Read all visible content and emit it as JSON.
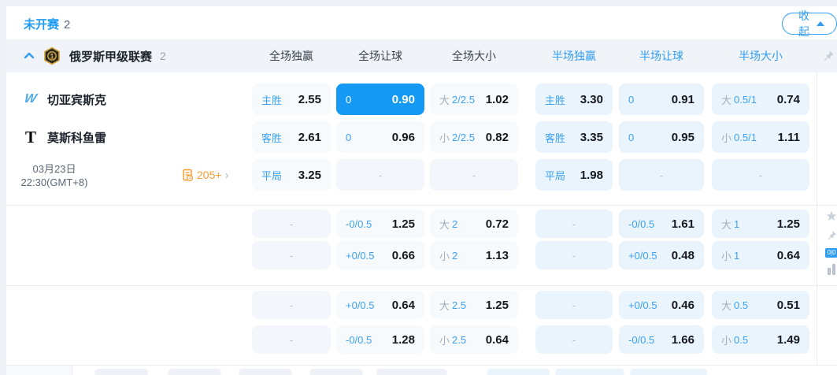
{
  "header": {
    "status_label": "未开赛",
    "status_count": "2",
    "collapse_button": "收起"
  },
  "league": {
    "name": "俄罗斯甲级联赛",
    "count": "2",
    "column_headers": [
      "全场独赢",
      "全场让球",
      "全场大小",
      "半场独赢",
      "半场让球",
      "半场大小"
    ]
  },
  "match": {
    "home_team": "切亚宾斯克",
    "away_team": "莫斯科鱼雷",
    "date": "03月23日",
    "time": "22:30(GMT+8)",
    "markets_count": "205+"
  },
  "side": {
    "score_tag": "0|0"
  },
  "colors": {
    "accent": "#1e9bf2",
    "selected_cell": "#149af4",
    "half_cell_bg": "#eaf4fd",
    "markets_orange": "#f79b30"
  },
  "odds": {
    "rows": [
      {
        "cells": [
          {
            "label": "主胜",
            "value": "2.55"
          },
          {
            "label": "0",
            "value": "0.90",
            "selected": true
          },
          {
            "prefix": "大",
            "label": "2/2.5",
            "value": "1.02"
          },
          {
            "label": "主胜",
            "value": "3.30"
          },
          {
            "label": "0",
            "value": "0.91"
          },
          {
            "prefix": "大",
            "label": "0.5/1",
            "value": "0.74"
          }
        ]
      },
      {
        "cells": [
          {
            "label": "客胜",
            "value": "2.61"
          },
          {
            "label": "0",
            "value": "0.96"
          },
          {
            "prefix": "小",
            "label": "2/2.5",
            "value": "0.82"
          },
          {
            "label": "客胜",
            "value": "3.35"
          },
          {
            "label": "0",
            "value": "0.95"
          },
          {
            "prefix": "小",
            "label": "0.5/1",
            "value": "1.11"
          }
        ]
      },
      {
        "cells": [
          {
            "label": "平局",
            "value": "3.25"
          },
          {
            "dash": "-"
          },
          {
            "dash": "-"
          },
          {
            "label": "平局",
            "value": "1.98"
          },
          {
            "dash": "-"
          },
          {
            "dash": "-"
          }
        ]
      },
      {
        "cells": [
          {
            "dash": "-"
          },
          {
            "label": "-0/0.5",
            "value": "1.25"
          },
          {
            "prefix": "大",
            "label": "2",
            "value": "0.72"
          },
          {
            "dash": "-"
          },
          {
            "label": "-0/0.5",
            "value": "1.61"
          },
          {
            "prefix": "大",
            "label": "1",
            "value": "1.25"
          }
        ]
      },
      {
        "cells": [
          {
            "dash": "-"
          },
          {
            "label": "+0/0.5",
            "value": "0.66"
          },
          {
            "prefix": "小",
            "label": "2",
            "value": "1.13"
          },
          {
            "dash": "-"
          },
          {
            "label": "+0/0.5",
            "value": "0.48"
          },
          {
            "prefix": "小",
            "label": "1",
            "value": "0.64"
          }
        ]
      },
      {
        "cells": [
          {
            "dash": "-"
          },
          {
            "label": "+0/0.5",
            "value": "0.64"
          },
          {
            "prefix": "大",
            "label": "2.5",
            "value": "1.25"
          },
          {
            "dash": "-"
          },
          {
            "label": "+0/0.5",
            "value": "0.46"
          },
          {
            "prefix": "大",
            "label": "0.5",
            "value": "0.51"
          }
        ]
      },
      {
        "cells": [
          {
            "dash": "-"
          },
          {
            "label": "-0/0.5",
            "value": "1.28"
          },
          {
            "prefix": "小",
            "label": "2.5",
            "value": "0.64"
          },
          {
            "dash": "-"
          },
          {
            "label": "-0/0.5",
            "value": "1.66"
          },
          {
            "prefix": "小",
            "label": "0.5",
            "value": "1.49"
          }
        ]
      }
    ]
  }
}
